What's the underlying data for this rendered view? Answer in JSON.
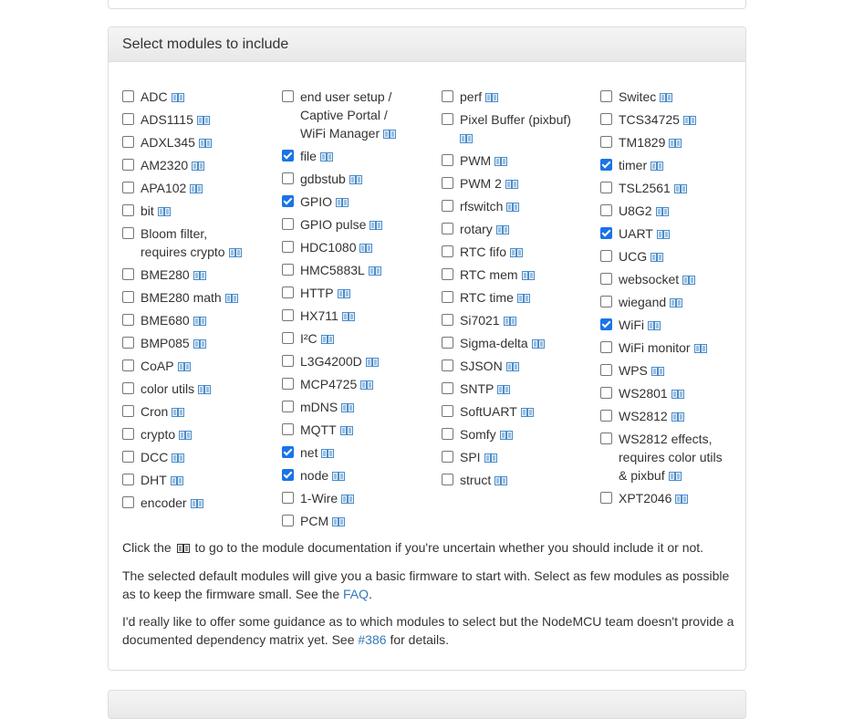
{
  "panel": {
    "title": "Select modules to include"
  },
  "columns": [
    [
      {
        "label": "ADC",
        "checked": false
      },
      {
        "label": "ADS1115",
        "checked": false
      },
      {
        "label": "ADXL345",
        "checked": false
      },
      {
        "label": "AM2320",
        "checked": false
      },
      {
        "label": "APA102",
        "checked": false
      },
      {
        "label": "bit",
        "checked": false
      },
      {
        "label": "Bloom filter,",
        "label2": "requires crypto",
        "checked": false
      },
      {
        "label": "BME280",
        "checked": false
      },
      {
        "label": "BME280 math",
        "checked": false
      },
      {
        "label": "BME680",
        "checked": false
      },
      {
        "label": "BMP085",
        "checked": false
      },
      {
        "label": "CoAP",
        "checked": false
      },
      {
        "label": "color utils",
        "checked": false
      },
      {
        "label": "Cron",
        "checked": false
      },
      {
        "label": "crypto",
        "checked": false
      },
      {
        "label": "DCC",
        "checked": false
      },
      {
        "label": "DHT",
        "checked": false
      },
      {
        "label": "encoder",
        "checked": false
      }
    ],
    [
      {
        "label": "end user setup /",
        "label2": "Captive Portal /",
        "label3": "WiFi Manager",
        "checked": false
      },
      {
        "label": "file",
        "checked": true
      },
      {
        "label": "gdbstub",
        "checked": false
      },
      {
        "label": "GPIO",
        "checked": true
      },
      {
        "label": "GPIO pulse",
        "checked": false
      },
      {
        "label": "HDC1080",
        "checked": false
      },
      {
        "label": "HMC5883L",
        "checked": false
      },
      {
        "label": "HTTP",
        "checked": false
      },
      {
        "label": "HX711",
        "checked": false
      },
      {
        "label": "I²C",
        "checked": false
      },
      {
        "label": "L3G4200D",
        "checked": false
      },
      {
        "label": "MCP4725",
        "checked": false
      },
      {
        "label": "mDNS",
        "checked": false
      },
      {
        "label": "MQTT",
        "checked": false
      },
      {
        "label": "net",
        "checked": true
      },
      {
        "label": "node",
        "checked": true
      },
      {
        "label": "1-Wire",
        "checked": false
      },
      {
        "label": "PCM",
        "checked": false
      }
    ],
    [
      {
        "label": "perf",
        "checked": false
      },
      {
        "label": "Pixel Buffer (pixbuf)",
        "checked": false,
        "icon_newline": true
      },
      {
        "label": "PWM",
        "checked": false
      },
      {
        "label": "PWM 2",
        "checked": false
      },
      {
        "label": "rfswitch",
        "checked": false
      },
      {
        "label": "rotary",
        "checked": false
      },
      {
        "label": "RTC fifo",
        "checked": false
      },
      {
        "label": "RTC mem",
        "checked": false
      },
      {
        "label": "RTC time",
        "checked": false
      },
      {
        "label": "Si7021",
        "checked": false
      },
      {
        "label": "Sigma-delta",
        "checked": false
      },
      {
        "label": "SJSON",
        "checked": false
      },
      {
        "label": "SNTP",
        "checked": false
      },
      {
        "label": "SoftUART",
        "checked": false
      },
      {
        "label": "Somfy",
        "checked": false
      },
      {
        "label": "SPI",
        "checked": false
      },
      {
        "label": "struct",
        "checked": false
      }
    ],
    [
      {
        "label": "Switec",
        "checked": false
      },
      {
        "label": "TCS34725",
        "checked": false
      },
      {
        "label": "TM1829",
        "checked": false
      },
      {
        "label": "timer",
        "checked": true
      },
      {
        "label": "TSL2561",
        "checked": false
      },
      {
        "label": "U8G2",
        "checked": false
      },
      {
        "label": "UART",
        "checked": true
      },
      {
        "label": "UCG",
        "checked": false
      },
      {
        "label": "websocket",
        "checked": false
      },
      {
        "label": "wiegand",
        "checked": false
      },
      {
        "label": "WiFi",
        "checked": true
      },
      {
        "label": "WiFi monitor",
        "checked": false
      },
      {
        "label": "WPS",
        "checked": false
      },
      {
        "label": "WS2801",
        "checked": false
      },
      {
        "label": "WS2812",
        "checked": false
      },
      {
        "label": "WS2812 effects,",
        "label2": "requires color utils",
        "label3": "& pixbuf",
        "checked": false
      },
      {
        "label": "XPT2046",
        "checked": false
      }
    ]
  ],
  "notes": {
    "p1_before": "Click the",
    "p1_after": "to go to the module documentation if you're uncertain whether you should include it or not.",
    "p2_text": "The selected default modules will give you a basic firmware to start with. Select as few modules as possible as to keep the firmware small. See the",
    "p2_link": "FAQ",
    "p2_end": ".",
    "p3_text": "I'd really like to offer some guidance as to which modules to select but the NodeMCU team doesn't provide a documented dependency matrix yet. See",
    "p3_link": "#386",
    "p3_end": "for details."
  },
  "colors": {
    "link": "#337ab7",
    "checkbox_checked": "#1a73e8",
    "doc_icon": "#4a8cc9"
  },
  "icons": {
    "doc": "book-icon"
  }
}
